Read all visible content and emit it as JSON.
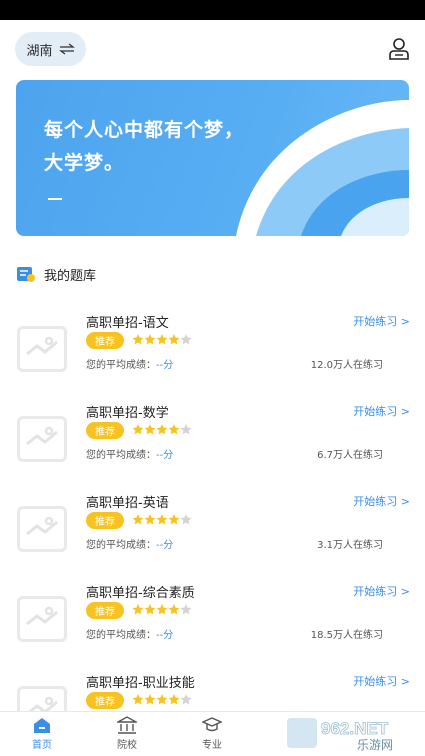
{
  "location": {
    "label": "湖南"
  },
  "banner": {
    "line1": "每个人心中都有个梦，",
    "line2": "大学梦。"
  },
  "section": {
    "title": "我的题库"
  },
  "cards": [
    {
      "title": "高职单招-语文",
      "badge": "推荐",
      "rating": 4,
      "avg_label": "您的平均成绩：",
      "avg_score": "--分",
      "count": "12.0万人在练习",
      "link": "开始练习 >"
    },
    {
      "title": "高职单招-数学",
      "badge": "推荐",
      "rating": 4,
      "avg_label": "您的平均成绩：",
      "avg_score": "--分",
      "count": "6.7万人在练习",
      "link": "开始练习 >"
    },
    {
      "title": "高职单招-英语",
      "badge": "推荐",
      "rating": 4,
      "avg_label": "您的平均成绩：",
      "avg_score": "--分",
      "count": "3.1万人在练习",
      "link": "开始练习 >"
    },
    {
      "title": "高职单招-综合素质",
      "badge": "推荐",
      "rating": 4,
      "avg_label": "您的平均成绩：",
      "avg_score": "--分",
      "count": "18.5万人在练习",
      "link": "开始练习 >"
    },
    {
      "title": "高职单招-职业技能",
      "badge": "推荐",
      "rating": 4,
      "link": "开始练习 >"
    }
  ],
  "tabs": [
    {
      "label": "首页",
      "icon": "home-icon",
      "active": true
    },
    {
      "label": "院校",
      "icon": "school-icon",
      "active": false
    },
    {
      "label": "专业",
      "icon": "graduation-cap-icon",
      "active": false
    }
  ],
  "watermark": {
    "text1": "962.NET",
    "text2": "乐游网"
  },
  "colors": {
    "accent": "#3a8ee6",
    "badge": "#f7c323",
    "banner": "#4da4ee"
  }
}
